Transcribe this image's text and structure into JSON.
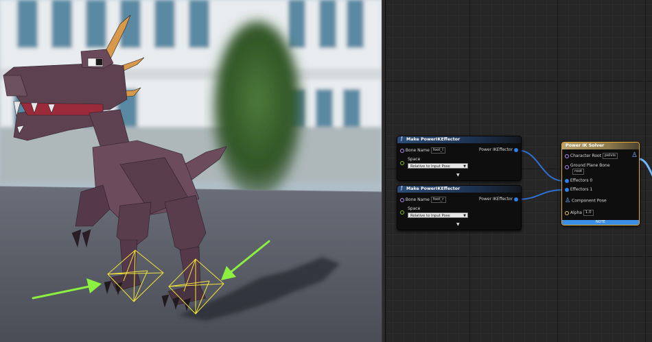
{
  "colors": {
    "graph_background": "#262626",
    "node_body": "#0e0e0e",
    "make_node_header": "#2d4b73",
    "solver_header": "#b9a46e",
    "solver_border": "#e6a82c",
    "wire_blue": "#2e6fd0",
    "note_bar": "#3a8fe5",
    "annotation_arrow": "#8cf040",
    "ik_gizmo": "#f5e43a"
  },
  "viewport": {
    "annotations": [
      "arrow-left-foot",
      "arrow-right-foot"
    ]
  },
  "nodes": {
    "make_effector_1": {
      "title": "Make PowerIKEffector",
      "bone_name_label": "Bone Name",
      "bone_name_value": "foot_l",
      "output_label": "Power IKEffector",
      "space_label": "Space",
      "space_value": "Relative to Input Pose",
      "expand_icon": "triangle-down"
    },
    "make_effector_2": {
      "title": "Make PowerIKEffector",
      "bone_name_label": "Bone Name",
      "bone_name_value": "foot_r",
      "output_label": "Power IKEffector",
      "space_label": "Space",
      "space_value": "Relative to Input Pose",
      "expand_icon": "triangle-down"
    },
    "solver": {
      "title": "Power IK Solver",
      "character_root_label": "Character Root",
      "character_root_value": "pelvis",
      "ground_plane_label": "Ground Plane Bone",
      "ground_plane_value": "root",
      "effectors_0_label": "Effectors 0",
      "effectors_1_label": "Effectors 1",
      "component_pose_label": "Component Pose",
      "alpha_label": "Alpha",
      "alpha_value": "1.0",
      "note": "NOTE",
      "pose_icon": "mannequin-icon"
    }
  }
}
